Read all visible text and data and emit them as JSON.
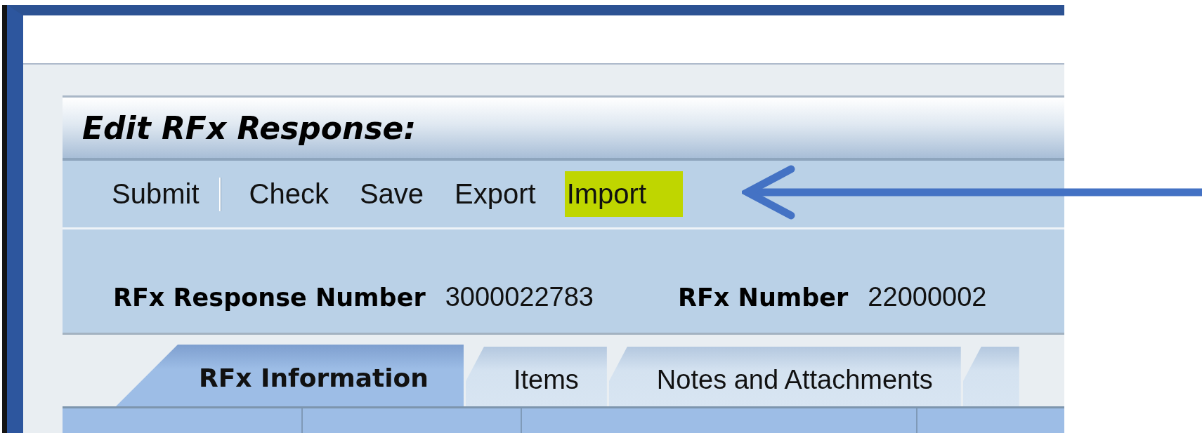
{
  "page": {
    "title": "Edit RFx Response:"
  },
  "toolbar": [
    {
      "kind": "action",
      "label": "Submit",
      "highlighted": false
    },
    {
      "kind": "separator"
    },
    {
      "kind": "action",
      "label": "Check",
      "highlighted": false
    },
    {
      "kind": "action",
      "label": "Save",
      "highlighted": false
    },
    {
      "kind": "action",
      "label": "Export",
      "highlighted": false
    },
    {
      "kind": "action",
      "label": "Import",
      "highlighted": true
    }
  ],
  "fields": [
    {
      "label": "RFx Response Number",
      "value": "3000022783"
    },
    {
      "label": "RFx Number",
      "value": "22000002"
    }
  ],
  "tabs": [
    {
      "label": "RFx Information",
      "selected": true
    },
    {
      "label": "Items",
      "selected": false
    },
    {
      "label": "Notes and Attachments",
      "selected": false
    },
    {
      "selected": false
    }
  ]
}
